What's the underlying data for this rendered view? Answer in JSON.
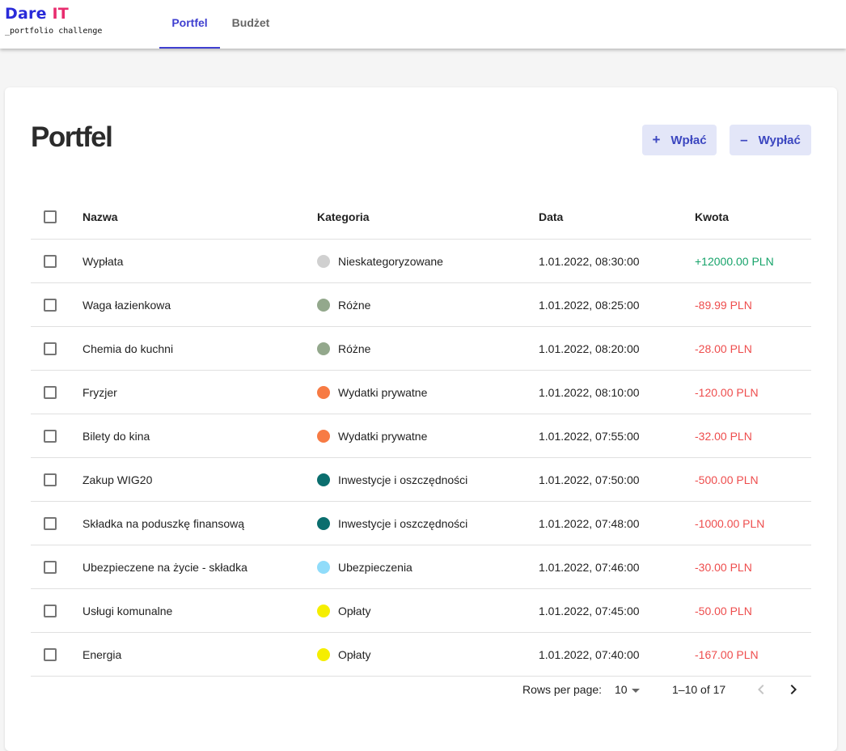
{
  "header": {
    "logo_main": "Dare",
    "logo_accent": "IT",
    "logo_sub": "_portfolio challenge",
    "tabs": [
      {
        "label": "Portfel"
      },
      {
        "label": "Budżet"
      }
    ],
    "colors": {
      "accent": "#3f3fd0",
      "logo_dare": "#2a2bd9",
      "logo_it": "#e82c6e"
    }
  },
  "page": {
    "title": "Portfel",
    "deposit_label": "Wpłać",
    "withdraw_label": "Wypłać",
    "deposit_icon": "plus-icon",
    "withdraw_icon": "minus-icon"
  },
  "table": {
    "columns": [
      "Nazwa",
      "Kategoria",
      "Data",
      "Kwota"
    ],
    "rows": [
      {
        "name": "Wypłata",
        "category": "Nieskategoryzowane",
        "color": "#d0d0d0",
        "date": "1.01.2022, 08:30:00",
        "amount": "+12000.00 PLN",
        "sign": "pos"
      },
      {
        "name": "Waga łazienkowa",
        "category": "Różne",
        "color": "#93a88c",
        "date": "1.01.2022, 08:25:00",
        "amount": "-89.99 PLN",
        "sign": "neg"
      },
      {
        "name": "Chemia do kuchni",
        "category": "Różne",
        "color": "#93a88c",
        "date": "1.01.2022, 08:20:00",
        "amount": "-28.00 PLN",
        "sign": "neg"
      },
      {
        "name": "Fryzjer",
        "category": "Wydatki prywatne",
        "color": "#f77b44",
        "date": "1.01.2022, 08:10:00",
        "amount": "-120.00 PLN",
        "sign": "neg"
      },
      {
        "name": "Bilety do kina",
        "category": "Wydatki prywatne",
        "color": "#f77b44",
        "date": "1.01.2022, 07:55:00",
        "amount": "-32.00 PLN",
        "sign": "neg"
      },
      {
        "name": "Zakup WIG20",
        "category": "Inwestycje i oszczędności",
        "color": "#0b6e6e",
        "date": "1.01.2022, 07:50:00",
        "amount": "-500.00 PLN",
        "sign": "neg"
      },
      {
        "name": "Składka na poduszkę finansową",
        "category": "Inwestycje i oszczędności",
        "color": "#0b6e6e",
        "date": "1.01.2022, 07:48:00",
        "amount": "-1000.00 PLN",
        "sign": "neg"
      },
      {
        "name": "Ubezpieczene na życie - składka",
        "category": "Ubezpieczenia",
        "color": "#90dcfa",
        "date": "1.01.2022, 07:46:00",
        "amount": "-30.00 PLN",
        "sign": "neg"
      },
      {
        "name": "Usługi komunalne",
        "category": "Opłaty",
        "color": "#f5ee00",
        "date": "1.01.2022, 07:45:00",
        "amount": "-50.00 PLN",
        "sign": "neg"
      },
      {
        "name": "Energia",
        "category": "Opłaty",
        "color": "#f5ee00",
        "date": "1.01.2022, 07:40:00",
        "amount": "-167.00 PLN",
        "sign": "neg"
      }
    ],
    "amount_colors": {
      "pos": "#16a36a",
      "neg": "#ee4d4d"
    }
  },
  "pagination": {
    "rows_per_page_label": "Rows per page:",
    "rows_per_page_value": "10",
    "range": "1–10 of 17",
    "prev_icon": "chevron-left-icon",
    "next_icon": "chevron-right-icon"
  }
}
